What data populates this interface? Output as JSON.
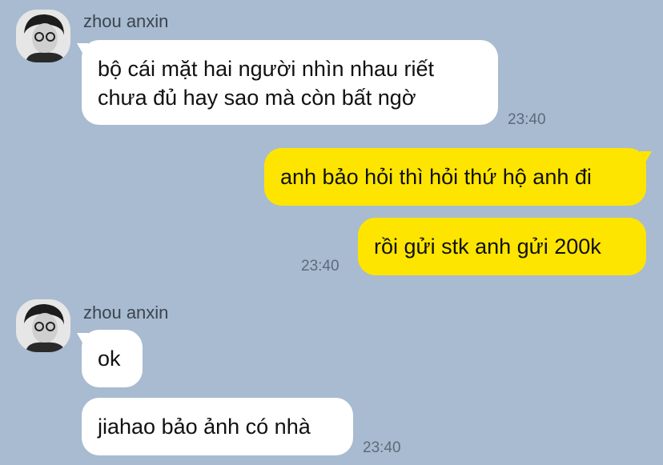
{
  "colors": {
    "background": "#a8bbd0",
    "incoming_bubble": "#ffffff",
    "outgoing_bubble": "#fee500"
  },
  "groups": [
    {
      "sender": "zhou anxin",
      "avatar_icon": "user-avatar-icon",
      "messages": [
        {
          "line1": "bộ cái mặt hai người nhìn nhau riết",
          "line2": "chưa đủ hay sao mà còn bất ngờ"
        }
      ],
      "time": "23:40"
    },
    {
      "outgoing": true,
      "messages": [
        {
          "text": "anh bảo hỏi thì hỏi thứ hộ anh đi"
        },
        {
          "text": "rồi gửi stk anh gửi 200k"
        }
      ],
      "time": "23:40"
    },
    {
      "sender": "zhou anxin",
      "avatar_icon": "user-avatar-icon",
      "messages": [
        {
          "text": "ok"
        },
        {
          "text": "jiahao bảo ảnh có nhà"
        }
      ],
      "time": "23:40"
    }
  ]
}
